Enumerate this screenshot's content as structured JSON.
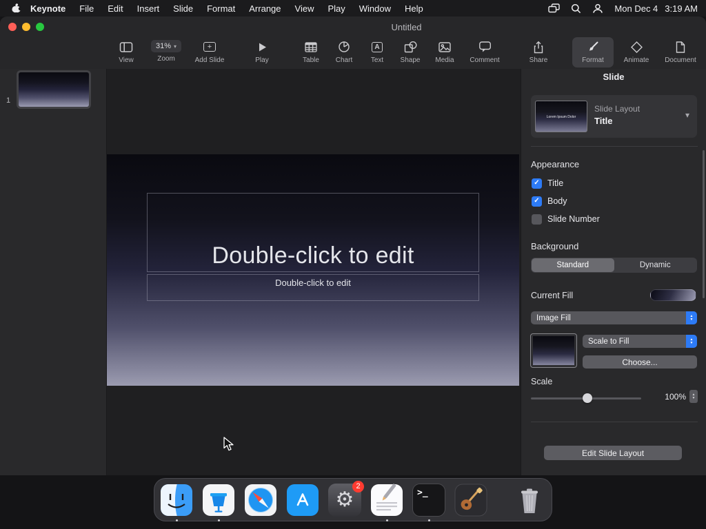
{
  "menu_bar": {
    "app_name": "Keynote",
    "menus": [
      "File",
      "Edit",
      "Insert",
      "Slide",
      "Format",
      "Arrange",
      "View",
      "Play",
      "Window",
      "Help"
    ],
    "date": "Mon Dec 4",
    "time": "3:19 AM"
  },
  "window": {
    "title": "Untitled"
  },
  "toolbar": {
    "view": "View",
    "zoom_value": "31%",
    "zoom": "Zoom",
    "add_slide": "Add Slide",
    "play": "Play",
    "table": "Table",
    "chart": "Chart",
    "text": "Text",
    "shape": "Shape",
    "media": "Media",
    "comment": "Comment",
    "share": "Share",
    "format": "Format",
    "animate": "Animate",
    "document": "Document"
  },
  "navigator": {
    "slide_number": "1"
  },
  "slide": {
    "title_placeholder": "Double-click to edit",
    "body_placeholder": "Double-click to edit"
  },
  "inspector": {
    "header": "Slide",
    "slide_layout": {
      "label": "Slide Layout",
      "value": "Title",
      "preview_title": "Lorem Ipsum Dolor"
    },
    "appearance": {
      "heading": "Appearance",
      "title": {
        "label": "Title",
        "checked": true
      },
      "body": {
        "label": "Body",
        "checked": true
      },
      "slide_number": {
        "label": "Slide Number",
        "checked": false
      }
    },
    "background": {
      "heading": "Background",
      "standard": "Standard",
      "dynamic": "Dynamic",
      "current_fill": "Current Fill",
      "fill_type": "Image Fill",
      "scale_mode": "Scale to Fill",
      "choose": "Choose...",
      "scale_label": "Scale",
      "scale_value": "100%"
    },
    "edit_slide_layout": "Edit Slide Layout"
  },
  "dock": {
    "settings_badge": "2"
  },
  "icons": {
    "chevron_down": "▾",
    "check": "✓",
    "plus": "+",
    "caret_up": "▲",
    "caret_down": "▼",
    "letter_a": "A",
    "gear": "⚙",
    "terminal_prompt": ">_"
  },
  "colors": {
    "accent_blue": "#2d7bf6",
    "badge_red": "#ff3b30"
  }
}
